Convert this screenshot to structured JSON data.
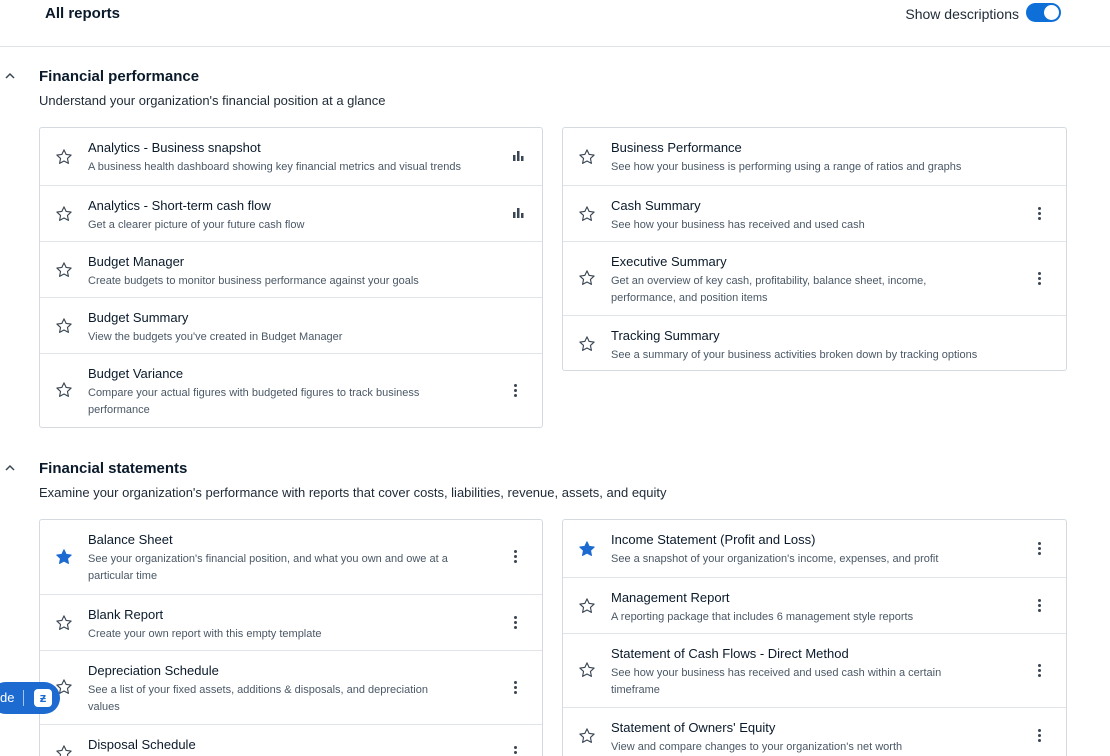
{
  "header": {
    "title": "All reports",
    "toggle_label": "Show descriptions",
    "toggle_on": true
  },
  "sections": [
    {
      "title": "Financial performance",
      "description": "Understand your organization's financial position at a glance",
      "left": [
        {
          "title": "Analytics - Business snapshot",
          "description": "A business health dashboard showing key financial metrics and visual trends",
          "starred": false,
          "action": "chart-icon"
        },
        {
          "title": "Analytics - Short-term cash flow",
          "description": "Get a clearer picture of your future cash flow",
          "starred": false,
          "action": "chart-icon"
        },
        {
          "title": "Budget Manager",
          "description": "Create budgets to monitor business performance against your goals",
          "starred": false,
          "action": "none"
        },
        {
          "title": "Budget Summary",
          "description": "View the budgets you've created in Budget Manager",
          "starred": false,
          "action": "none"
        },
        {
          "title": "Budget Variance",
          "description": "Compare your actual figures with budgeted figures to track business performance",
          "starred": false,
          "action": "more-icon"
        }
      ],
      "right": [
        {
          "title": "Business Performance",
          "description": "See how your business is performing using a range of ratios and graphs",
          "starred": false,
          "action": "none"
        },
        {
          "title": "Cash Summary",
          "description": "See how your business has received and used cash",
          "starred": false,
          "action": "more-icon"
        },
        {
          "title": "Executive Summary",
          "description": "Get an overview of key cash, profitability, balance sheet, income, performance, and position items",
          "starred": false,
          "action": "more-icon"
        },
        {
          "title": "Tracking Summary",
          "description": "See a summary of your business activities broken down by tracking options",
          "starred": false,
          "action": "none"
        }
      ]
    },
    {
      "title": "Financial statements",
      "description": "Examine your organization's performance with reports that cover costs, liabilities, revenue, assets, and equity",
      "left": [
        {
          "title": "Balance Sheet",
          "description": "See your organization's financial position, and what you own and owe at a particular time",
          "starred": true,
          "action": "more-icon"
        },
        {
          "title": "Blank Report",
          "description": "Create your own report with this empty template",
          "starred": false,
          "action": "more-icon"
        },
        {
          "title": "Depreciation Schedule",
          "description": "See a list of your fixed assets, additions & disposals, and depreciation values",
          "starred": false,
          "action": "more-icon"
        },
        {
          "title": "Disposal Schedule",
          "description": "",
          "starred": false,
          "action": "more-icon"
        }
      ],
      "right": [
        {
          "title": "Income Statement (Profit and Loss)",
          "description": "See a snapshot of your organization's income, expenses, and profit",
          "starred": true,
          "action": "more-icon"
        },
        {
          "title": "Management Report",
          "description": "A reporting package that includes 6 management style reports",
          "starred": false,
          "action": "more-icon"
        },
        {
          "title": "Statement of Cash Flows - Direct Method",
          "description": "See how your business has received and used cash within a certain timeframe",
          "starred": false,
          "action": "more-icon"
        },
        {
          "title": "Statement of Owners' Equity",
          "description": "View and compare changes to your organization's net worth",
          "starred": false,
          "action": "more-icon"
        }
      ]
    }
  ],
  "help_widget": {
    "label": "de",
    "logo": "ƶ"
  },
  "colors": {
    "accent": "#0f6fd8",
    "star_filled": "#1d6bd1",
    "border": "#d5dae0"
  }
}
